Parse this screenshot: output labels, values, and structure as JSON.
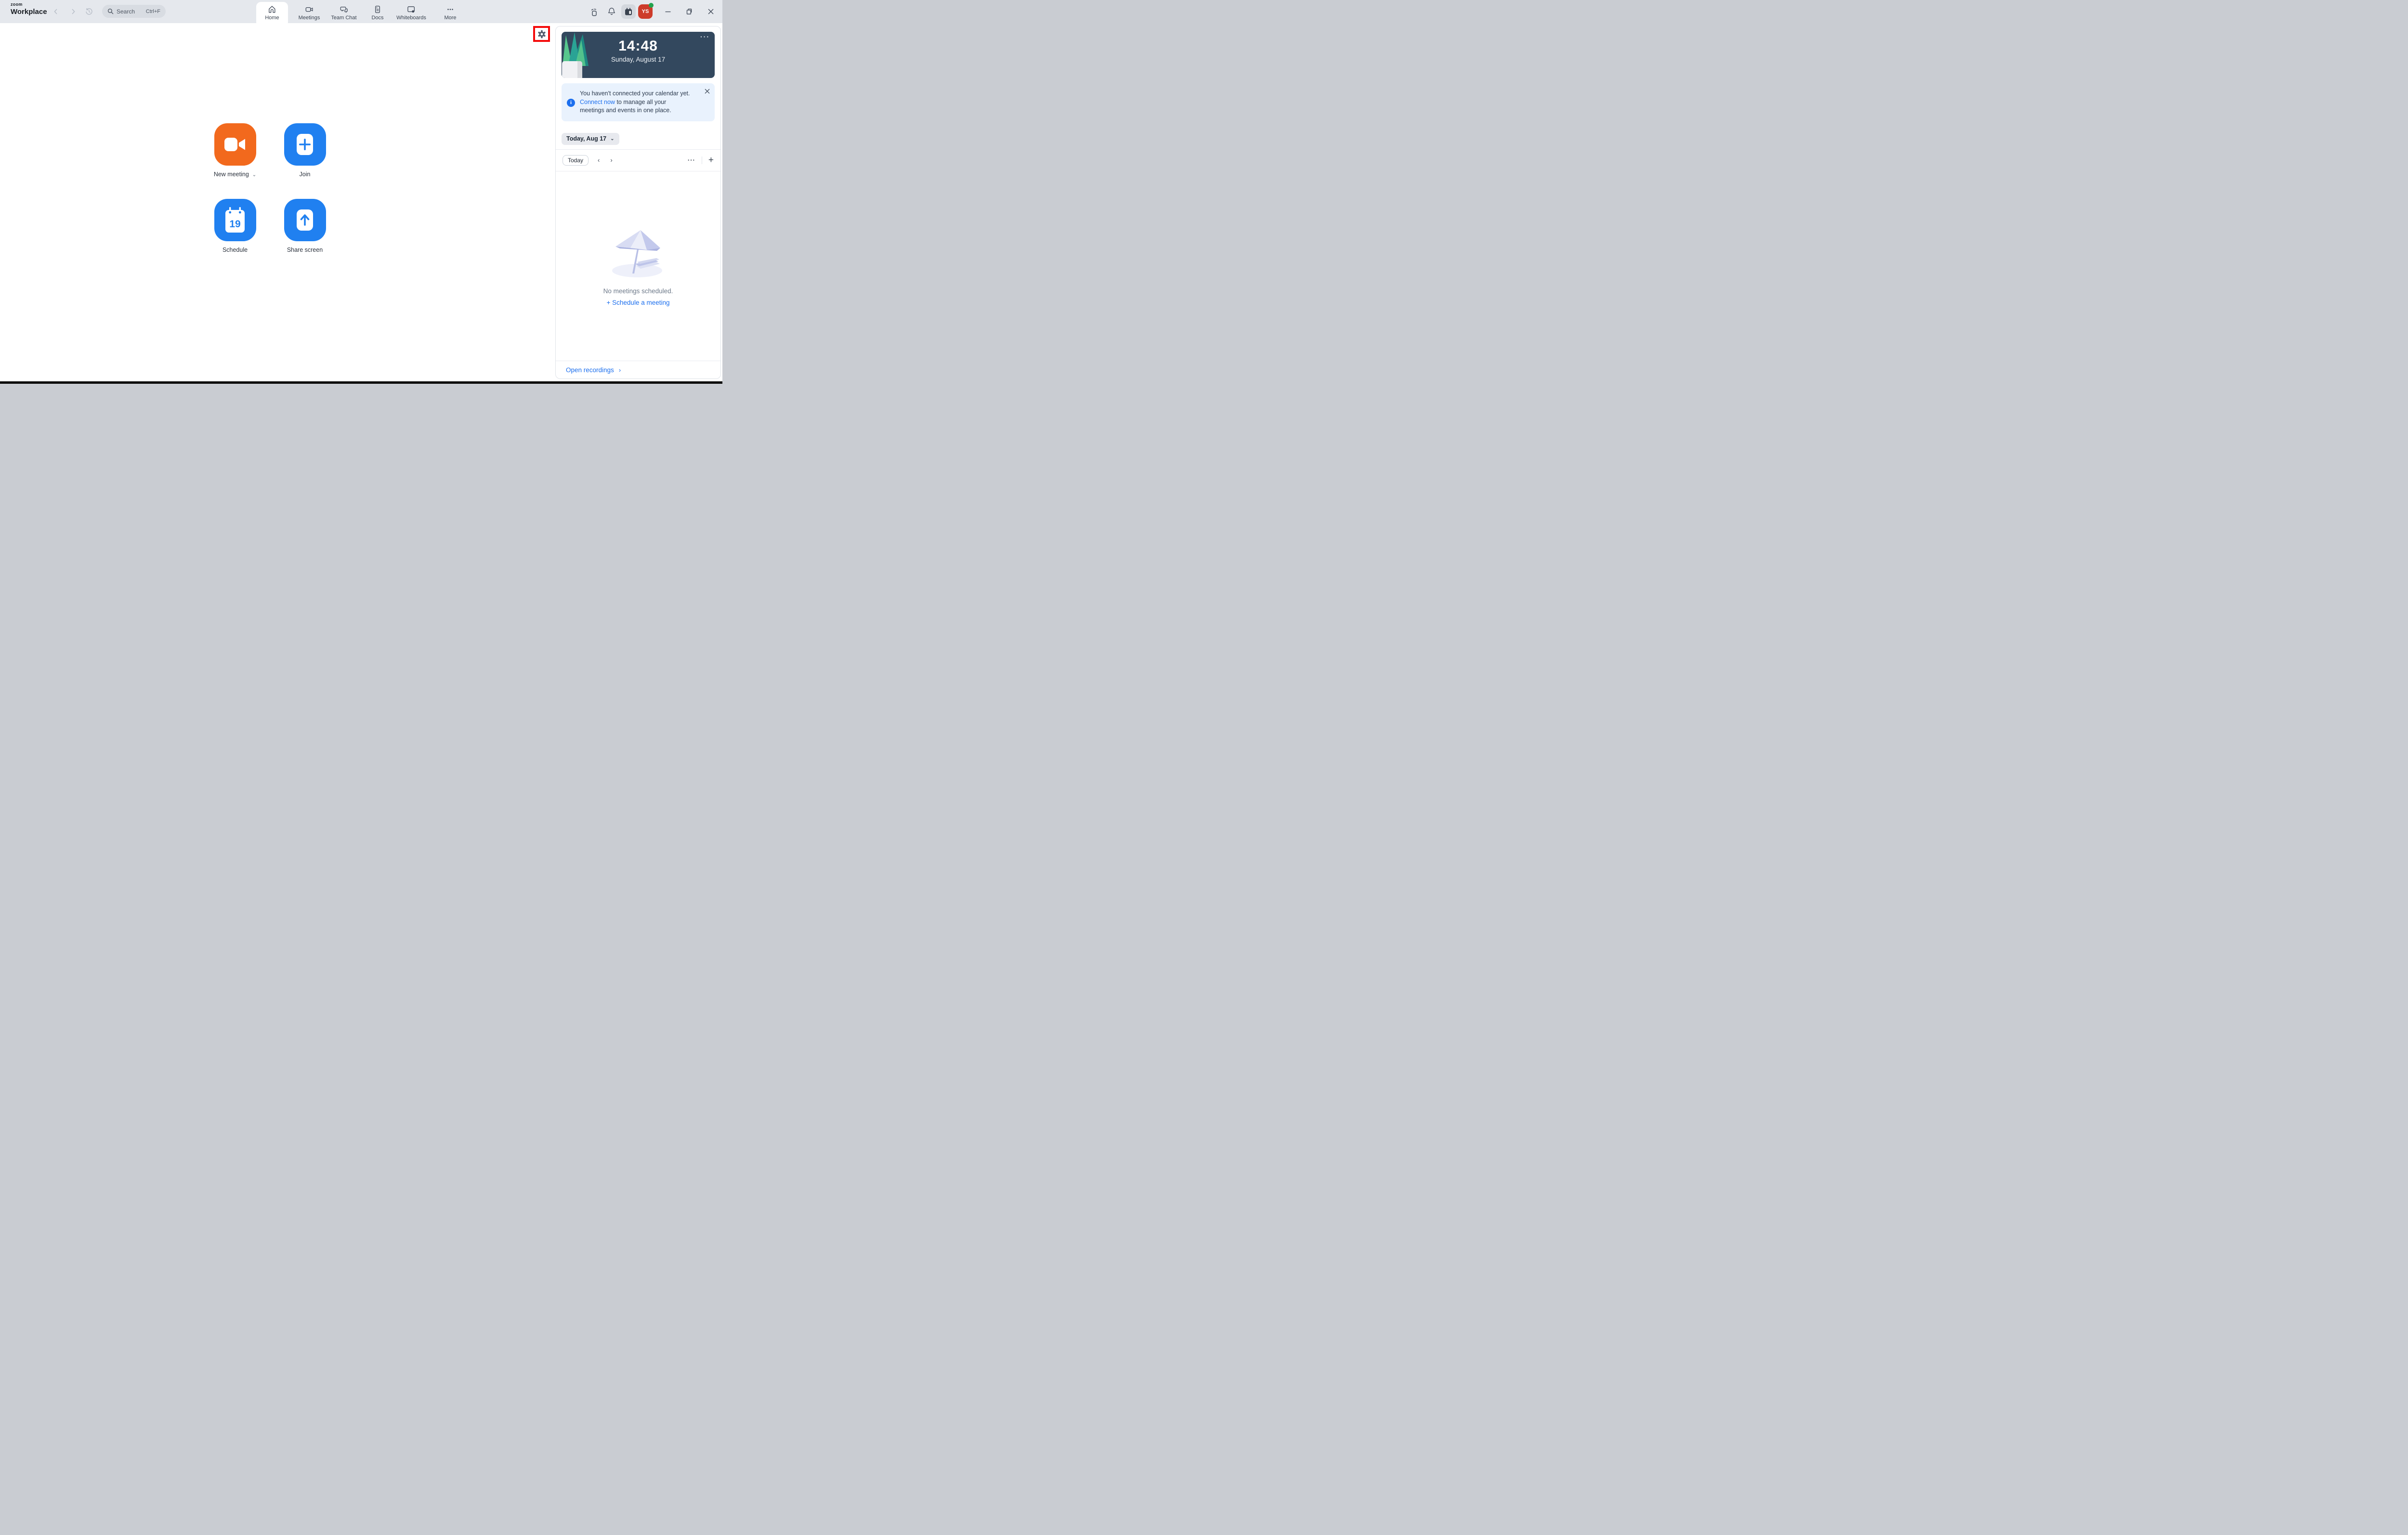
{
  "app": {
    "logo_top": "zoom",
    "logo_bottom": "Workplace"
  },
  "titlebar": {
    "search": {
      "placeholder": "Search",
      "shortcut": "Ctrl+F"
    },
    "tabs": [
      {
        "label": "Home",
        "active": true
      },
      {
        "label": "Meetings",
        "active": false
      },
      {
        "label": "Team Chat",
        "active": false
      },
      {
        "label": "Docs",
        "active": false
      },
      {
        "label": "Whiteboards",
        "active": false
      },
      {
        "label": "More",
        "active": false
      }
    ],
    "profile": {
      "initials": "YS",
      "status": "online"
    }
  },
  "main": {
    "actions": [
      {
        "label": "New meeting",
        "has_dropdown": true,
        "color": "#f2691d",
        "icon": "video-camera-icon"
      },
      {
        "label": "Join",
        "has_dropdown": false,
        "color": "#2080f0",
        "icon": "plus-icon"
      },
      {
        "label": "Schedule",
        "has_dropdown": false,
        "color": "#2080f0",
        "icon": "calendar-icon",
        "calendar_day": "19"
      },
      {
        "label": "Share screen",
        "has_dropdown": false,
        "color": "#2080f0",
        "icon": "arrow-up-icon"
      }
    ]
  },
  "panel": {
    "clock": {
      "time": "14:48",
      "date": "Sunday, August 17"
    },
    "banner": {
      "line1": "You haven't connected your calendar yet.",
      "link_label": "Connect now",
      "line2_rest": " to manage all your",
      "line3": "meetings and events in one place."
    },
    "date_selector": {
      "label": "Today, Aug 17"
    },
    "toolbar": {
      "today": "Today"
    },
    "empty_state": {
      "title": "No meetings scheduled.",
      "action_label": "Schedule a meeting",
      "action_prefix": "+"
    },
    "footer": {
      "link_label": "Open recordings"
    }
  },
  "glyphs": {
    "back": "‹",
    "forward": "›",
    "dropdown": "⌄",
    "overflow": "···",
    "chev_left": "‹",
    "chev_right": "›",
    "plus": "+",
    "footer_chev": "›"
  },
  "colors": {
    "titlebar_bg": "#e5e8ed",
    "accent_blue": "#1c6fee",
    "tile_blue": "#2080f0",
    "tile_orange": "#f2691d",
    "clock_card_bg": "#33485e",
    "banner_bg": "#e9f2fd",
    "avatar_bg": "#cd3b2a",
    "presence_green": "#23a24e",
    "annotation_red": "#f40b0b"
  }
}
